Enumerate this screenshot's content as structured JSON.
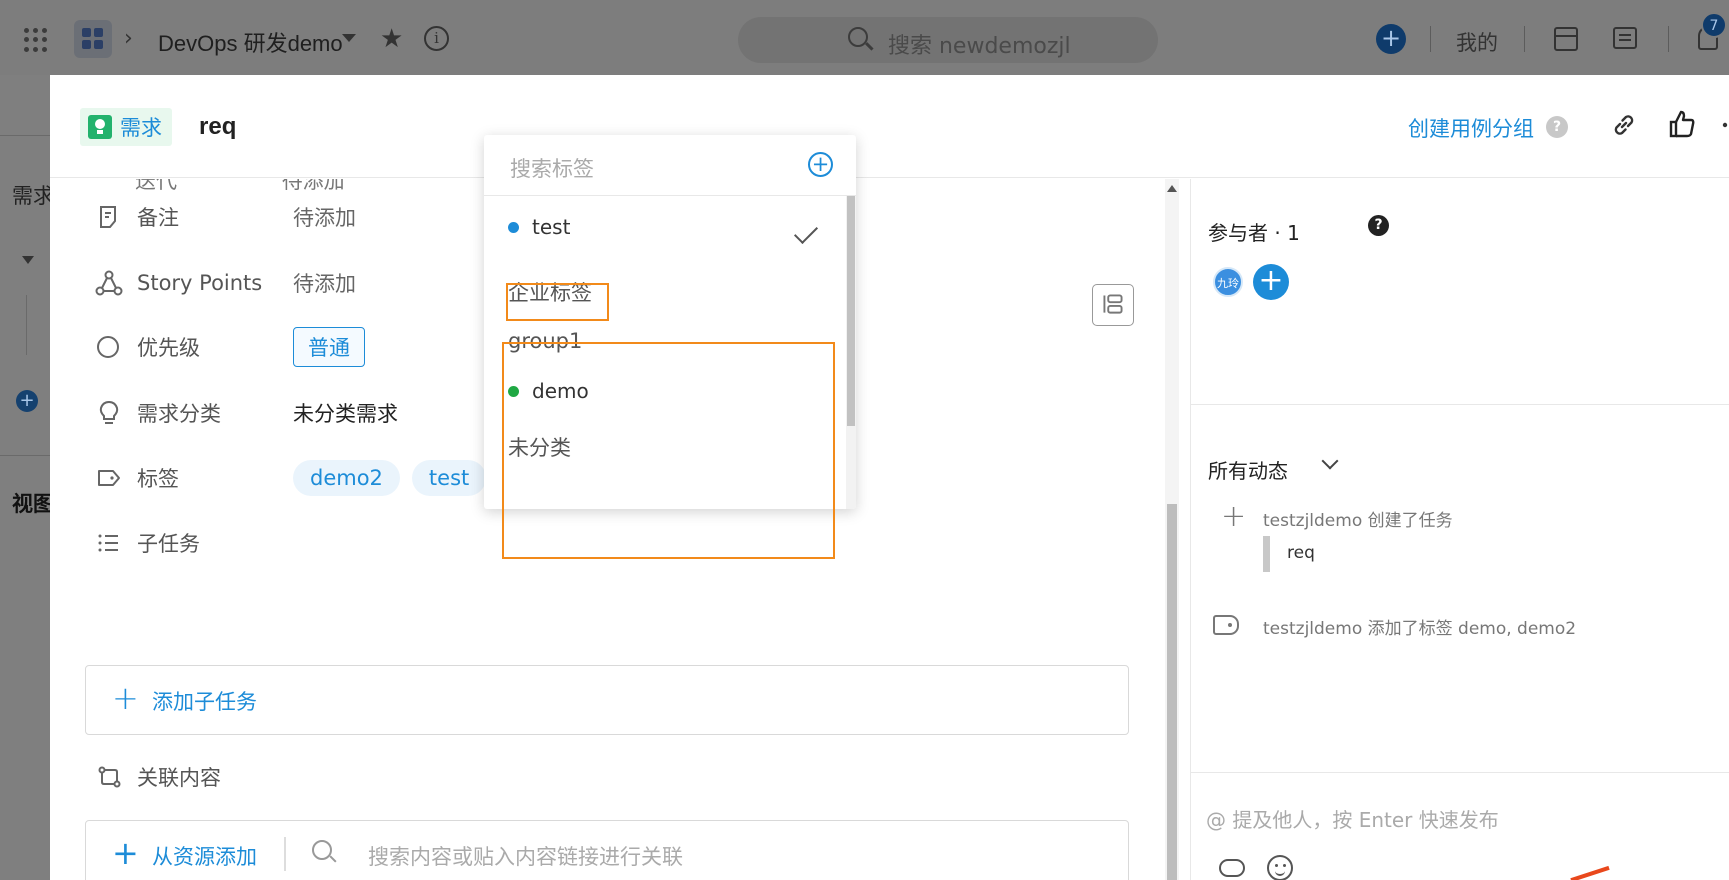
{
  "topbar": {
    "project_name": "DevOps 研发demo",
    "search_placeholder": "搜索 newdemozjl",
    "mine_label": "我的",
    "notification_count": "7"
  },
  "background": {
    "left_label_1": "需求",
    "left_label_2": "视图"
  },
  "modal": {
    "type_label": "需求",
    "title": "req",
    "create_case_group": "创建用例分组",
    "help": "?"
  },
  "properties": {
    "partial_label": "迭代",
    "partial_value": "待添加",
    "rows": [
      {
        "label": "备注",
        "value": "待添加"
      },
      {
        "label": "Story Points",
        "value": "待添加"
      },
      {
        "label": "优先级",
        "value": "普通"
      },
      {
        "label": "需求分类",
        "value": "未分类需求"
      },
      {
        "label": "标签",
        "value": ""
      },
      {
        "label": "子任务",
        "value": ""
      }
    ],
    "tags": [
      "demo2",
      "test"
    ],
    "add_subtask": "添加子任务",
    "related_content": "关联内容",
    "add_from_resource": "从资源添加",
    "resource_search_placeholder": "搜索内容或贴入内容链接进行关联"
  },
  "tag_dropdown": {
    "search_placeholder": "搜索标签",
    "items": [
      {
        "name": "test",
        "dot_color": "#1d8cd8",
        "checked": true
      },
      {
        "group": "企业标签"
      },
      {
        "group": "group1"
      },
      {
        "name": "demo",
        "dot_color": "#1fa843",
        "checked": false
      },
      {
        "group": "未分类"
      }
    ]
  },
  "right_panel": {
    "participants_title": "参与者 · 1",
    "avatar_text": "九玲",
    "activity_filter": "所有动态",
    "activities": [
      {
        "text": "testzjldemo 创建了任务",
        "quote": "req"
      },
      {
        "text": "testzjldemo 添加了标签 demo, demo2"
      }
    ],
    "comment_placeholder": "@ 提及他人，按 Enter 快速发布"
  },
  "colors": {
    "accent": "#1d8cd8",
    "highlight": "#f28a1a",
    "requirement_green": "#23b26d"
  }
}
